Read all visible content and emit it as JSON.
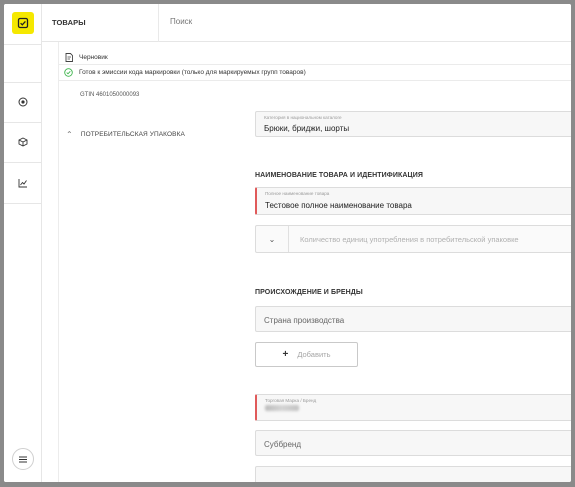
{
  "topbar": {
    "title": "ТОВАРЫ",
    "search_placeholder": "Поиск"
  },
  "rail": {
    "icons": [
      "logo-checkbox-icon",
      "target-icon",
      "cube-icon",
      "chart-icon",
      "menu-icon"
    ]
  },
  "status": {
    "draft": "Черновик",
    "ready": "Готов к эмиссии кода маркировки (только для маркируемых групп товаров)"
  },
  "gtin": "GTIN 4601050000093",
  "package_section": "ПОТРЕБИТЕЛЬСКАЯ УПАКОВКА",
  "category": {
    "label": "Категория в национальном каталоге",
    "value": "Брюки, бриджи, шорты"
  },
  "naming_section": {
    "title": "НАИМЕНОВАНИЕ ТОВАРА И ИДЕНТИФИКАЦИЯ",
    "full_name_label": "Полное наименование товара",
    "full_name_value": "Тестовое полное наименование товара",
    "quantity_placeholder": "Количество единиц употребления в потребительской упаковке"
  },
  "origin_section": {
    "title": "ПРОИСХОЖДЕНИЕ И БРЕНДЫ",
    "country_placeholder": "Страна производства",
    "add_button": "Добавить",
    "brand_label": "Торговая Марка / Бренд",
    "subbrand_placeholder": "Суббренд"
  },
  "colors": {
    "accent": "#f5e800",
    "success": "#3cb44b",
    "required": "#e05a5a"
  }
}
